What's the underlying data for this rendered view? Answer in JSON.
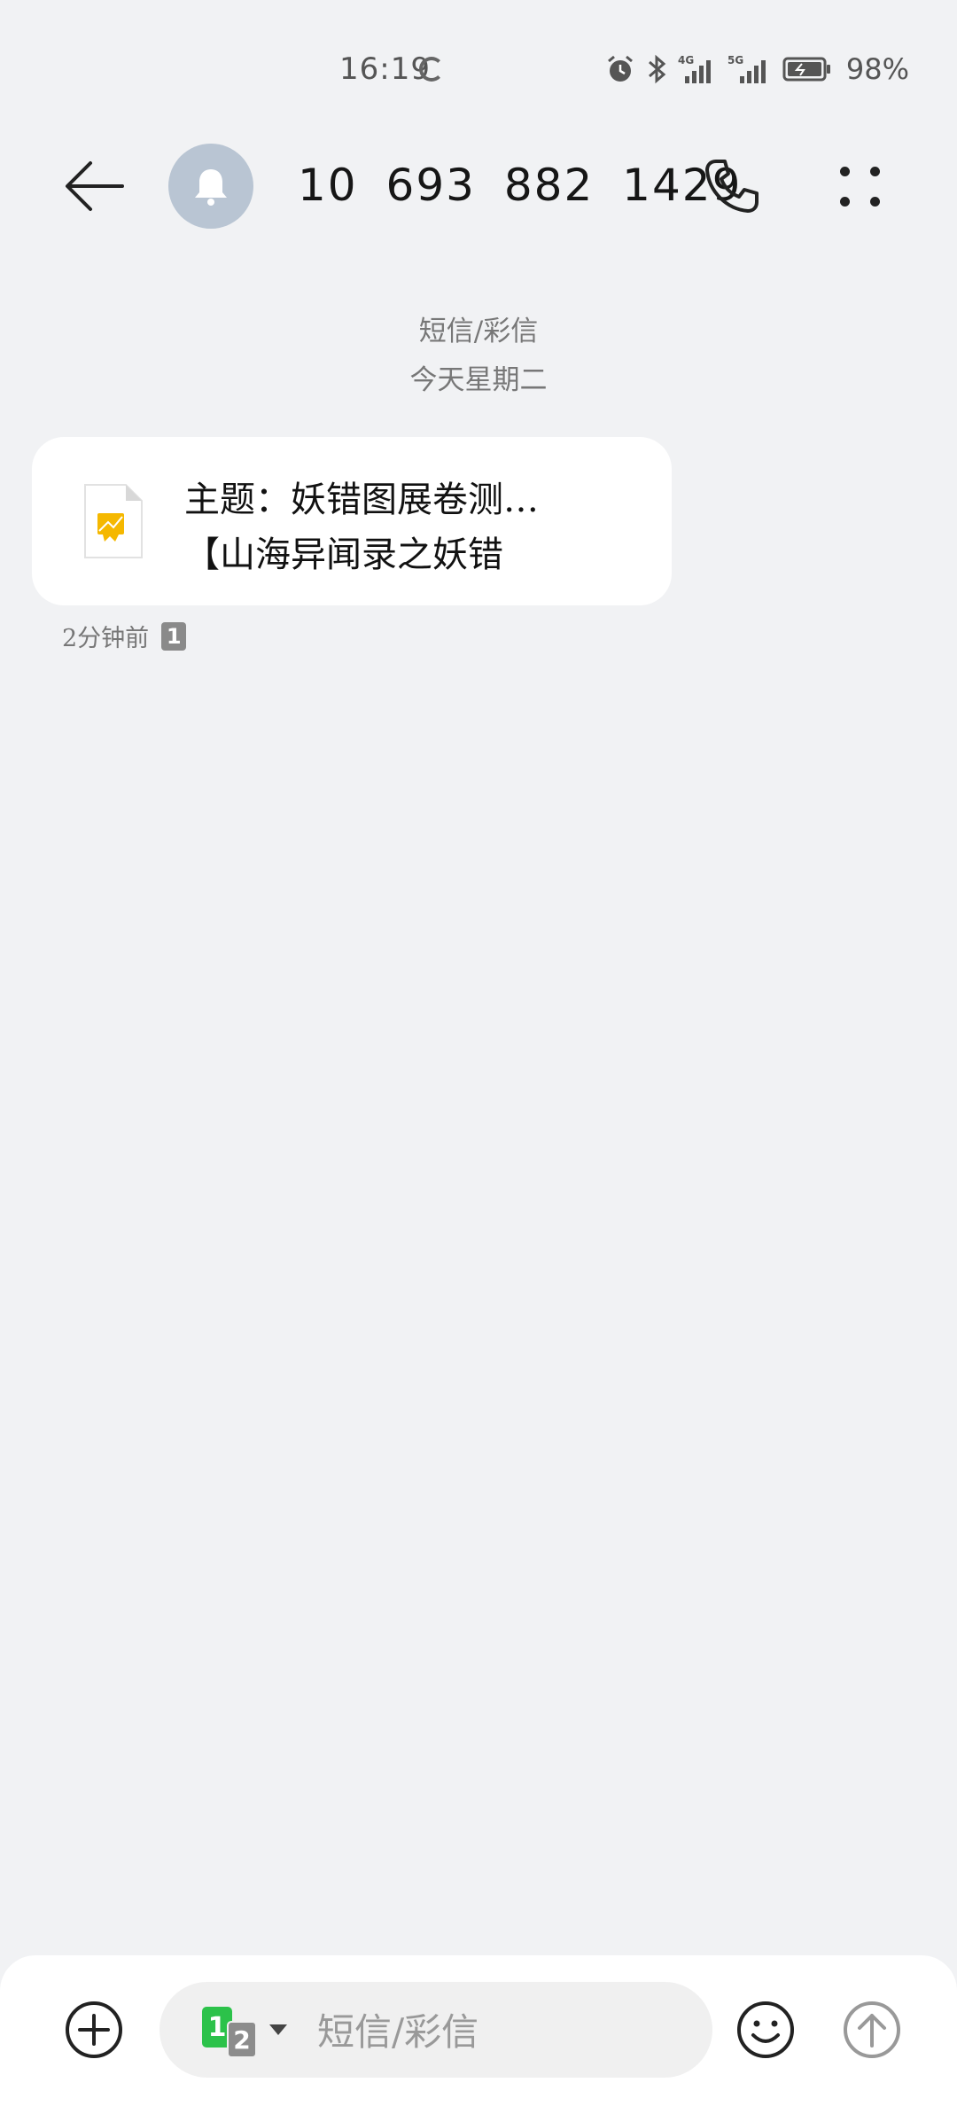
{
  "status_bar": {
    "time": "16:19",
    "network_1": "4G",
    "network_2": "5G",
    "battery_percent": "98%"
  },
  "header": {
    "contact_number": "10 693 882 1429",
    "avatar_icon": "bell-icon"
  },
  "conversation": {
    "type_label": "短信/彩信",
    "date_label": "今天星期二"
  },
  "message": {
    "subject": "主题：妖错图展卷测…",
    "body_preview": "【山海异闻录之妖错",
    "time": "2分钟前",
    "sim_badge": "1",
    "attachment_icon": "file-image-icon"
  },
  "composer": {
    "sim_primary": "1",
    "sim_secondary": "2",
    "placeholder": "短信/彩信"
  },
  "colors": {
    "background": "#f1f2f4",
    "bubble": "#ffffff",
    "avatar": "#b9c5d3",
    "sim1_green": "#2cc24a",
    "attachment_yellow": "#f5b800"
  }
}
